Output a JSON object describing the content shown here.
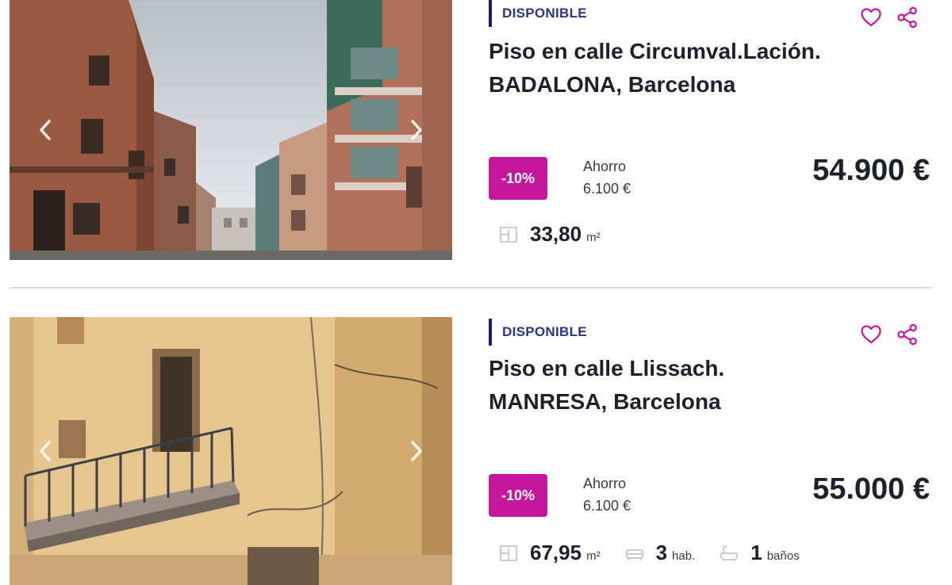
{
  "listings": [
    {
      "status": "DISPONIBLE",
      "title_line1": "Piso en calle Circumval.Lación.",
      "title_line2": "BADALONA, Barcelona",
      "discount": "-10%",
      "saving_label": "Ahorro",
      "saving_amount": "6.100 €",
      "price": "54.900 €",
      "area": "33,80",
      "area_unit": "m²"
    },
    {
      "status": "DISPONIBLE",
      "title_line1": "Piso en calle Llissach.",
      "title_line2": "MANRESA, Barcelona",
      "discount": "-10%",
      "saving_label": "Ahorro",
      "saving_amount": "6.100 €",
      "price": "55.000 €",
      "area": "67,95",
      "area_unit": "m²",
      "rooms": "3",
      "rooms_unit": "hab.",
      "baths": "1",
      "baths_unit": "baños"
    }
  ],
  "icons": {
    "favorite": "heart-icon",
    "share": "share-icon",
    "area": "floorplan-icon",
    "rooms": "bed-icon",
    "baths": "bathtub-icon",
    "prev": "chevron-left-icon",
    "next": "chevron-right-icon"
  },
  "colors": {
    "accent": "#c4159b",
    "status_bar": "#1a1d6b",
    "status_text": "#2d3580"
  }
}
